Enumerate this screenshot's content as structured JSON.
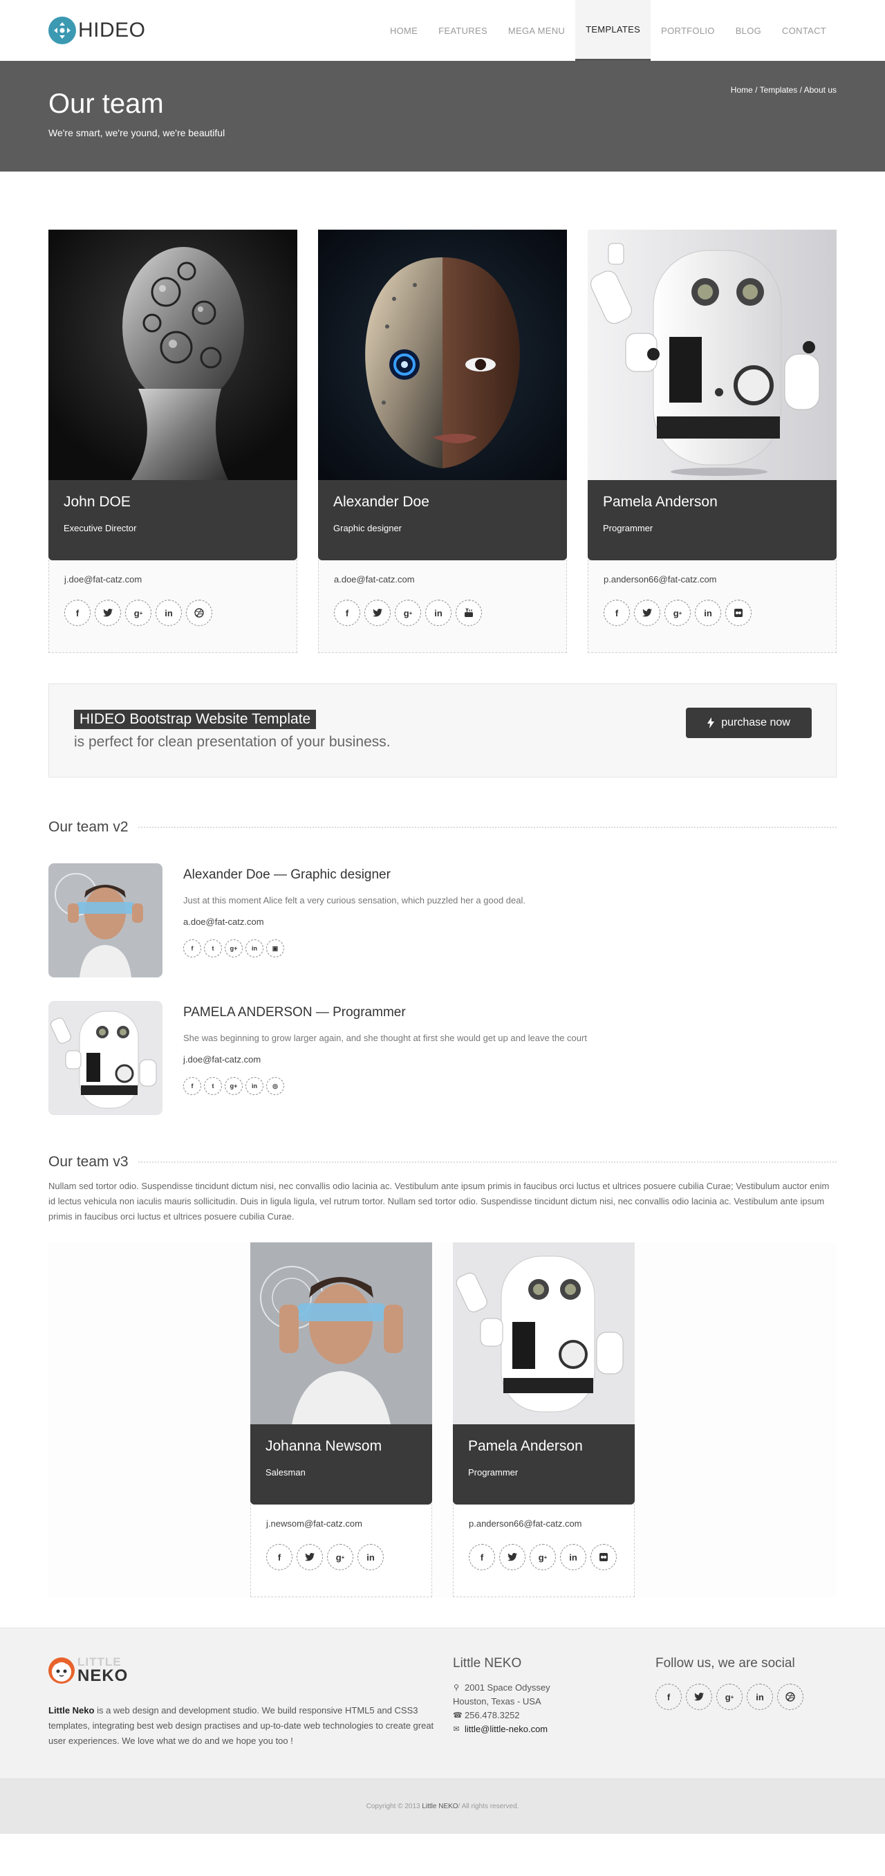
{
  "header": {
    "logo_text": "HIDEO",
    "nav": [
      "HOME",
      "FEATURES",
      "MEGA MENU",
      "TEMPLATES",
      "PORTFOLIO",
      "BLOG",
      "CONTACT"
    ]
  },
  "titlebar": {
    "title": "Our team",
    "subtitle": "We're smart, we're yound, we're beautiful",
    "breadcrumb": "Home / Templates / About us"
  },
  "team": [
    {
      "name": "John DOE",
      "role": "Executive Director",
      "email": "j.doe@fat-catz.com",
      "socials": [
        "f",
        "t",
        "g+",
        "in",
        "dribbble"
      ]
    },
    {
      "name": "Alexander Doe",
      "role": "Graphic designer",
      "email": "a.doe@fat-catz.com",
      "socials": [
        "f",
        "t",
        "g+",
        "in",
        "youtube"
      ]
    },
    {
      "name": "Pamela Anderson",
      "role": "Programmer",
      "email": "p.anderson66@fat-catz.com",
      "socials": [
        "f",
        "t",
        "g+",
        "in",
        "flickr"
      ]
    }
  ],
  "cta": {
    "title": "HIDEO Bootstrap Website Template",
    "text": "is perfect for clean presentation of your business.",
    "button": "purchase now"
  },
  "team_v2": {
    "heading": "Our team v2",
    "members": [
      {
        "title": "Alexander Doe — Graphic designer",
        "desc": "Just at this moment Alice felt a very curious sensation, which puzzled her a good deal.",
        "email": "a.doe@fat-catz.com"
      },
      {
        "title": "PAMELA ANDERSON — Programmer",
        "desc": "She was beginning to grow larger again, and she thought at first she would get up and leave the court",
        "email": "j.doe@fat-catz.com"
      }
    ]
  },
  "team_v3": {
    "heading": "Our team v3",
    "text": "Nullam sed tortor odio. Suspendisse tincidunt dictum nisi, nec convallis odio lacinia ac. Vestibulum ante ipsum primis in faucibus orci luctus et ultrices posuere cubilia Curae; Vestibulum auctor enim id lectus vehicula non iaculis mauris sollicitudin. Duis in ligula ligula, vel rutrum tortor. Nullam sed tortor odio. Suspendisse tincidunt dictum nisi, nec convallis odio lacinia ac. Vestibulum ante ipsum primis in faucibus orci luctus et ultrices posuere cubilia Curae.",
    "cards": [
      {
        "name": "Johanna Newsom",
        "role": "Salesman",
        "email": "j.newsom@fat-catz.com"
      },
      {
        "name": "Pamela Anderson",
        "role": "Programmer",
        "email": "p.anderson66@fat-catz.com"
      }
    ]
  },
  "footer": {
    "logo_little": "LITTLE",
    "logo_name": "NEKO",
    "about_brand": "Little Neko",
    "about_text": " is a web design and development studio. We build responsive HTML5 and CSS3 templates, integrating best web design practises and up-to-date web technologies to create great user experiences. We love what we do and we hope you too !",
    "col2_heading": "Little NEKO",
    "address1": "2001 Space Odyssey",
    "address2": "Houston, Texas - USA",
    "phone": "256.478.3252",
    "email": "little@little-neko.com",
    "col3_heading": "Follow us, we are social",
    "copyright_prefix": "Copyright © 2013 ",
    "copyright_brand": "Little NEKO",
    "copyright_suffix": " / All rights reserved."
  }
}
